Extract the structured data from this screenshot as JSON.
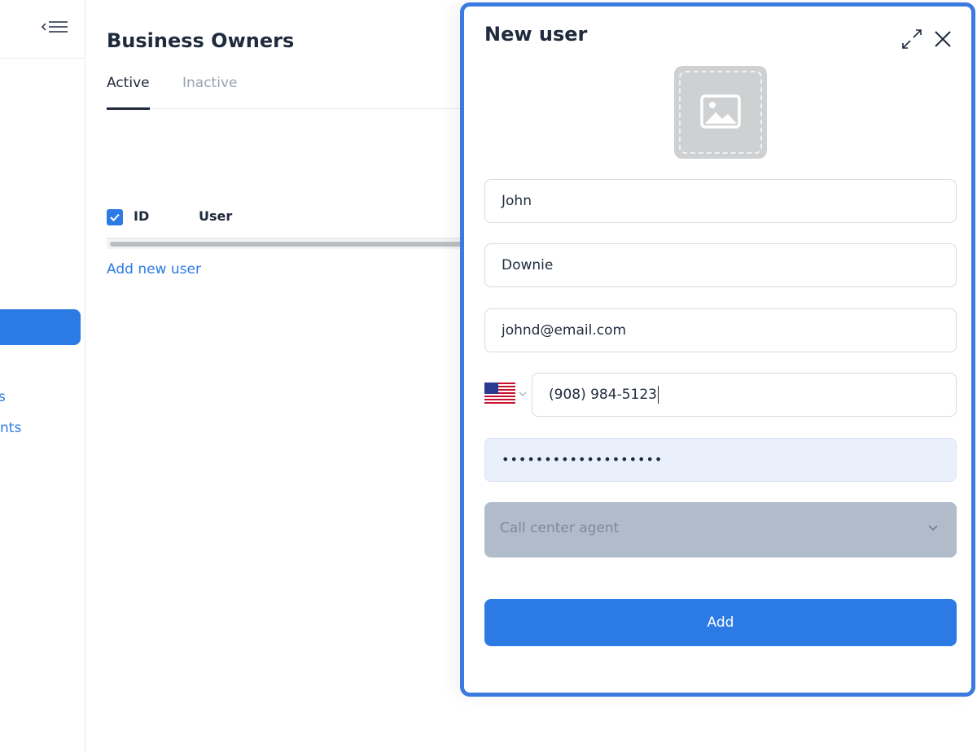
{
  "sidebar": {
    "collapse_icon": "collapse-menu-icon",
    "fragment_1": "s",
    "fragment_2": "nts",
    "accent": "#2c7be5"
  },
  "main": {
    "title": "Business Owners",
    "tabs": [
      {
        "label": "Active",
        "active": true
      },
      {
        "label": "Inactive",
        "active": false
      }
    ],
    "table": {
      "columns": [
        "ID",
        "User"
      ],
      "select_all_checked": true
    },
    "add_new_user_label": "Add new user"
  },
  "drawer": {
    "title": "New user",
    "expand_icon": "expand-icon",
    "close_icon": "close-icon",
    "avatar_icon": "image-icon",
    "fields": {
      "first_name": "John",
      "last_name": "Downie",
      "email": "johnd@email.com",
      "phone_country_flag": "us-flag-icon",
      "phone": "(908) 984-5123",
      "password": "•••••••••••••••••••"
    },
    "role": {
      "selected": "Call center agent"
    },
    "add_label": "Add"
  },
  "colors": {
    "accent": "#2c7be5",
    "drawer_border": "#3b7ae0",
    "text_dark": "#1f2a3c",
    "text_muted": "#98a3b3"
  }
}
